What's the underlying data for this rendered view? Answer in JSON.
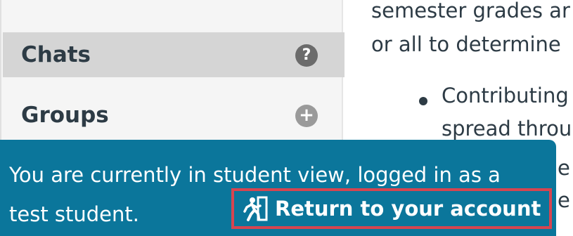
{
  "sidebar": {
    "items": [
      {
        "label": "Chats",
        "icon": "help-icon",
        "icon_glyph": "?"
      },
      {
        "label": "Groups",
        "icon": "add-icon",
        "icon_glyph": "+"
      }
    ]
  },
  "content": {
    "lines": [
      "semester grades ar",
      "or all to determine"
    ],
    "bullet_lines": [
      "Contributing",
      "spread throu",
      "e",
      "e"
    ]
  },
  "banner": {
    "message": "You are currently in student view, logged in as a test student.",
    "return_button_label": "Return to your account",
    "return_button_icon": "running-person-icon",
    "background": "#0b769b",
    "highlight_border": "#d64550"
  }
}
